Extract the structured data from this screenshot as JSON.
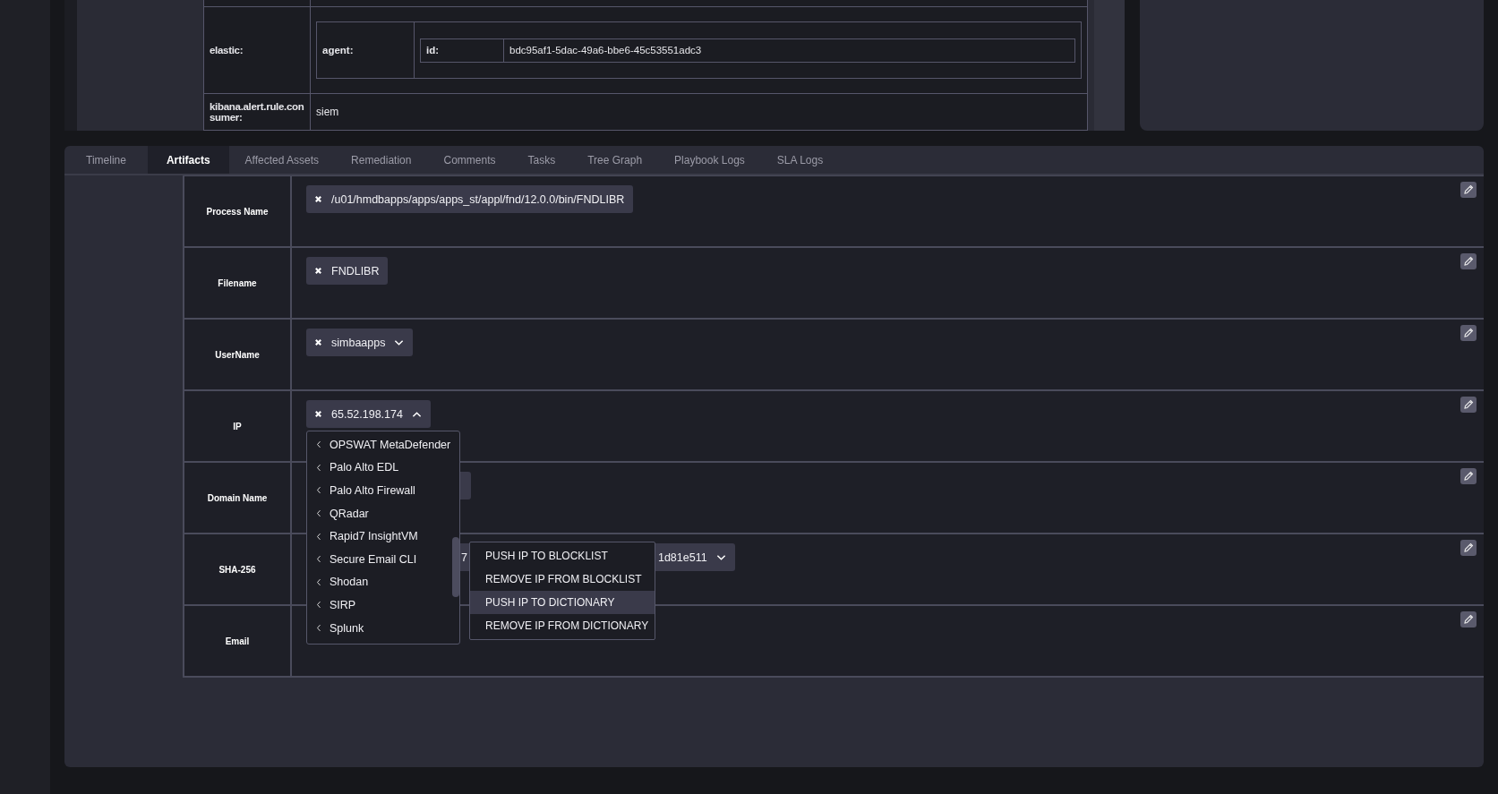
{
  "details_table": {
    "rows": [
      {
        "label": "elastic:",
        "nested": {
          "label": "agent:",
          "nested": {
            "label": "id:",
            "value": "bdc95af1-5dac-49a6-bbe6-45c53551adc3"
          }
        }
      },
      {
        "label": "kibana.alert.rule.consumer:",
        "value": "siem"
      }
    ]
  },
  "tabs": [
    {
      "label": "Timeline",
      "selected": false
    },
    {
      "label": "Artifacts",
      "selected": true
    },
    {
      "label": "Affected Assets",
      "selected": false
    },
    {
      "label": "Remediation",
      "selected": false
    },
    {
      "label": "Comments",
      "selected": false
    },
    {
      "label": "Tasks",
      "selected": false
    },
    {
      "label": "Tree Graph",
      "selected": false
    },
    {
      "label": "Playbook Logs",
      "selected": false
    },
    {
      "label": "SLA Logs",
      "selected": false
    }
  ],
  "artifacts": [
    {
      "label": "Process Name",
      "tags": [
        {
          "text": "/u01/hmdbapps/apps/apps_st/appl/fnd/12.0.0/bin/FNDLIBR"
        }
      ]
    },
    {
      "label": "Filename",
      "tags": [
        {
          "text": "FNDLIBR"
        }
      ]
    },
    {
      "label": "UserName",
      "tags": [
        {
          "text": "simbaapps",
          "expanded": false
        }
      ]
    },
    {
      "label": "IP",
      "tags": [
        {
          "text": "65.52.198.174",
          "expanded": true,
          "menu": {
            "items": [
              {
                "label": "OPSWAT MetaDefender"
              },
              {
                "label": "Palo Alto EDL"
              },
              {
                "label": "Palo Alto Firewall"
              },
              {
                "label": "QRadar"
              },
              {
                "label": "Rapid7 InsightVM"
              },
              {
                "label": "Secure Email CLI",
                "submenu": [
                  {
                    "label": "PUSH IP TO BLOCKLIST",
                    "selected": false
                  },
                  {
                    "label": "REMOVE IP FROM BLOCKLIST",
                    "selected": false
                  },
                  {
                    "label": "PUSH IP TO DICTIONARY",
                    "selected": true
                  },
                  {
                    "label": "REMOVE IP FROM DICTIONARY",
                    "selected": false
                  }
                ]
              },
              {
                "label": "Shodan"
              },
              {
                "label": "SIRP"
              },
              {
                "label": "Splunk"
              }
            ]
          }
        }
      ]
    },
    {
      "label": "Domain Name",
      "tags": [
        {
          "kind": "covered"
        }
      ]
    },
    {
      "label": "SHA-256",
      "tags": [
        {
          "kind": "split",
          "head": "7",
          "tail": "1d81e511",
          "expanded": false
        }
      ]
    },
    {
      "label": "Email"
    }
  ]
}
